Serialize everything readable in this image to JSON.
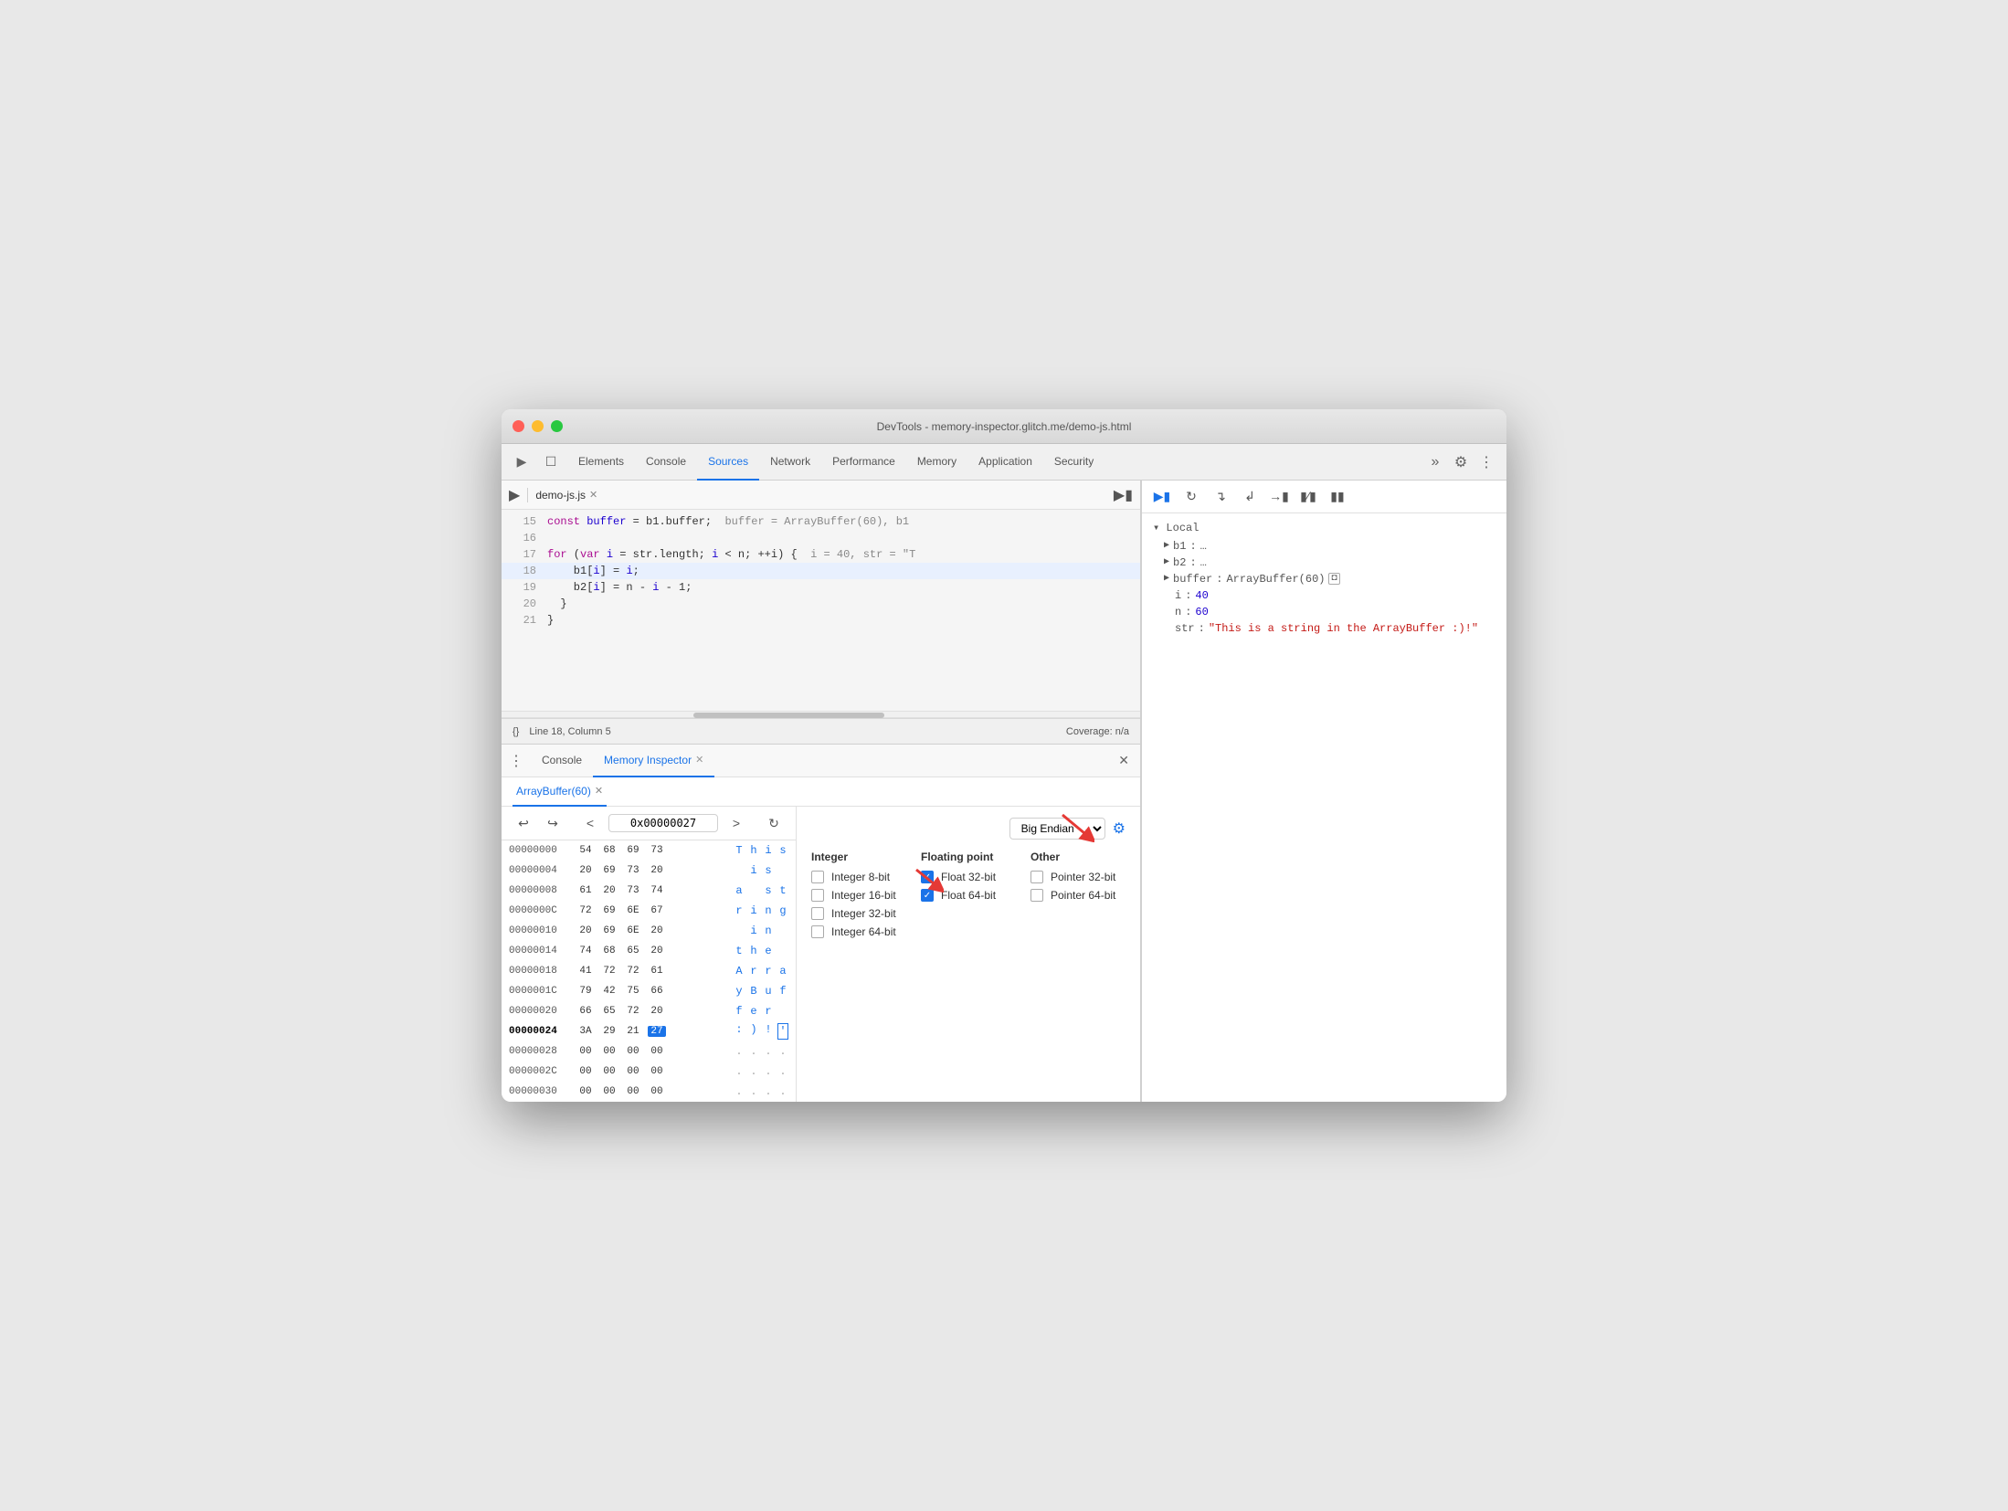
{
  "window": {
    "title": "DevTools - memory-inspector.glitch.me/demo-js.html"
  },
  "titlebar": {
    "close": "close",
    "minimize": "minimize",
    "maximize": "maximize"
  },
  "devtools_tabs": {
    "tabs": [
      {
        "label": "Elements",
        "active": false
      },
      {
        "label": "Console",
        "active": false
      },
      {
        "label": "Sources",
        "active": true
      },
      {
        "label": "Network",
        "active": false
      },
      {
        "label": "Performance",
        "active": false
      },
      {
        "label": "Memory",
        "active": false
      },
      {
        "label": "Application",
        "active": false
      },
      {
        "label": "Security",
        "active": false
      }
    ],
    "more_label": "»"
  },
  "sources": {
    "file_tab": "demo-js.js",
    "lines": [
      {
        "num": "15",
        "content": "  const buffer = b1.buffer;  buffer = ArrayBuffer(60), b1",
        "highlighted": false
      },
      {
        "num": "16",
        "content": "",
        "highlighted": false
      },
      {
        "num": "17",
        "content": "  for (var i = str.length; i < n; ++i) {  i = 40, str = \"T",
        "highlighted": false
      },
      {
        "num": "18",
        "content": "    b1[i] = i;",
        "highlighted": true
      },
      {
        "num": "19",
        "content": "    b2[i] = n - i - 1;",
        "highlighted": false
      },
      {
        "num": "20",
        "content": "  }",
        "highlighted": false
      },
      {
        "num": "21",
        "content": "}",
        "highlighted": false
      }
    ],
    "status": "Line 18, Column 5",
    "coverage": "Coverage: n/a"
  },
  "panel_tabs": {
    "tabs": [
      {
        "label": "Console",
        "active": false,
        "closeable": false
      },
      {
        "label": "Memory Inspector",
        "active": true,
        "closeable": true
      }
    ]
  },
  "memory_inspector": {
    "arraybuffer_tab": "ArrayBuffer(60)",
    "nav": {
      "back": "←",
      "forward": "→",
      "prev": "<",
      "next": ">",
      "address": "0x00000027",
      "refresh": "↻"
    },
    "endian": "Big Endian",
    "rows": [
      {
        "addr": "00000000",
        "bytes": [
          "54",
          "68",
          "69",
          "73"
        ],
        "ascii": [
          "T",
          "h",
          "i",
          "s"
        ],
        "active": false
      },
      {
        "addr": "00000004",
        "bytes": [
          "20",
          "69",
          "73",
          "20"
        ],
        "ascii": [
          " ",
          "i",
          "s",
          " "
        ],
        "active": false
      },
      {
        "addr": "00000008",
        "bytes": [
          "61",
          "20",
          "73",
          "74"
        ],
        "ascii": [
          "a",
          " ",
          "s",
          "t"
        ],
        "active": false
      },
      {
        "addr": "0000000C",
        "bytes": [
          "72",
          "69",
          "6E",
          "67"
        ],
        "ascii": [
          "r",
          "i",
          "n",
          "g"
        ],
        "active": false
      },
      {
        "addr": "00000010",
        "bytes": [
          "20",
          "69",
          "6E",
          "20"
        ],
        "ascii": [
          " ",
          "i",
          "n",
          " "
        ],
        "active": false
      },
      {
        "addr": "00000014",
        "bytes": [
          "74",
          "68",
          "65",
          "20"
        ],
        "ascii": [
          "t",
          "h",
          "e",
          " "
        ],
        "active": false
      },
      {
        "addr": "00000018",
        "bytes": [
          "41",
          "72",
          "72",
          "61"
        ],
        "ascii": [
          "A",
          "r",
          "r",
          "a"
        ],
        "active": false
      },
      {
        "addr": "0000001C",
        "bytes": [
          "79",
          "42",
          "75",
          "66"
        ],
        "ascii": [
          "y",
          "B",
          "u",
          "f"
        ],
        "active": false
      },
      {
        "addr": "00000020",
        "bytes": [
          "66",
          "65",
          "72",
          "20"
        ],
        "ascii": [
          "f",
          "e",
          "r",
          " "
        ],
        "active": false
      },
      {
        "addr": "00000024",
        "bytes": [
          "3A",
          "29",
          "21",
          "27"
        ],
        "ascii": [
          ":",
          ")",
          " ",
          "'"
        ],
        "active": true,
        "highlighted_byte": 3
      },
      {
        "addr": "00000028",
        "bytes": [
          "00",
          "00",
          "00",
          "00"
        ],
        "ascii": [
          ".",
          ".",
          ".",
          "."
        ],
        "active": false
      },
      {
        "addr": "0000002C",
        "bytes": [
          "00",
          "00",
          "00",
          "00"
        ],
        "ascii": [
          ".",
          ".",
          ".",
          "."
        ],
        "active": false
      },
      {
        "addr": "00000030",
        "bytes": [
          "00",
          "00",
          "00",
          "00"
        ],
        "ascii": [
          ".",
          ".",
          ".",
          "."
        ],
        "active": false
      }
    ],
    "types": {
      "integer_header": "Integer",
      "float_header": "Floating point",
      "other_header": "Other",
      "integer_types": [
        {
          "label": "Integer 8-bit",
          "checked": false
        },
        {
          "label": "Integer 16-bit",
          "checked": false
        },
        {
          "label": "Integer 32-bit",
          "checked": false
        },
        {
          "label": "Integer 64-bit",
          "checked": false
        }
      ],
      "float_types": [
        {
          "label": "Float 32-bit",
          "checked": true
        },
        {
          "label": "Float 64-bit",
          "checked": true
        }
      ],
      "other_types": [
        {
          "label": "Pointer 32-bit",
          "checked": false
        },
        {
          "label": "Pointer 64-bit",
          "checked": false
        }
      ]
    }
  },
  "debugger": {
    "scope_header": "▾ Local",
    "items": [
      {
        "key": "b1",
        "val": "…",
        "type": "arrow"
      },
      {
        "key": "b2",
        "val": "…",
        "type": "arrow"
      },
      {
        "key": "buffer",
        "val": "ArrayBuffer(60)",
        "type": "arrow",
        "has_icon": true
      },
      {
        "key": "i",
        "val": "40",
        "type": "num"
      },
      {
        "key": "n",
        "val": "60",
        "type": "num"
      },
      {
        "key": "str",
        "val": "\"This is a string in the ArrayBuffer :)!\"",
        "type": "string"
      }
    ]
  }
}
